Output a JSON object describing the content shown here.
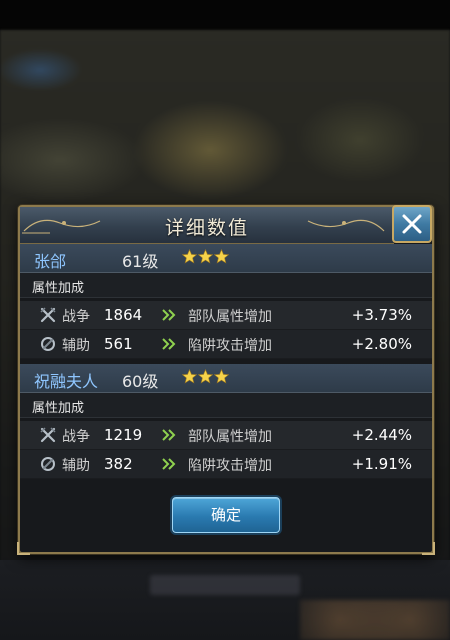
{
  "dialog": {
    "title": "详细数值",
    "confirm_label": "确定"
  },
  "heroes": [
    {
      "name": "张郃",
      "level": "61级",
      "stars": 3,
      "section_label": "属性加成",
      "stats": [
        {
          "type": "战争",
          "value": "1864",
          "desc": "部队属性增加",
          "bonus": "+3.73%",
          "icon": "crossed-swords-icon"
        },
        {
          "type": "辅助",
          "value": "561",
          "desc": "陷阱攻击增加",
          "bonus": "+2.80%",
          "icon": "support-icon"
        }
      ]
    },
    {
      "name": "祝融夫人",
      "level": "60级",
      "stars": 3,
      "section_label": "属性加成",
      "stats": [
        {
          "type": "战争",
          "value": "1219",
          "desc": "部队属性增加",
          "bonus": "+2.44%",
          "icon": "crossed-swords-icon"
        },
        {
          "type": "辅助",
          "value": "382",
          "desc": "陷阱攻击增加",
          "bonus": "+1.91%",
          "icon": "support-icon"
        }
      ]
    }
  ],
  "colors": {
    "hero_name": "#8fc6ff",
    "star": "#f5d24a",
    "arrow": "#8fd14f",
    "frame_gold": "#8d7a4c"
  }
}
